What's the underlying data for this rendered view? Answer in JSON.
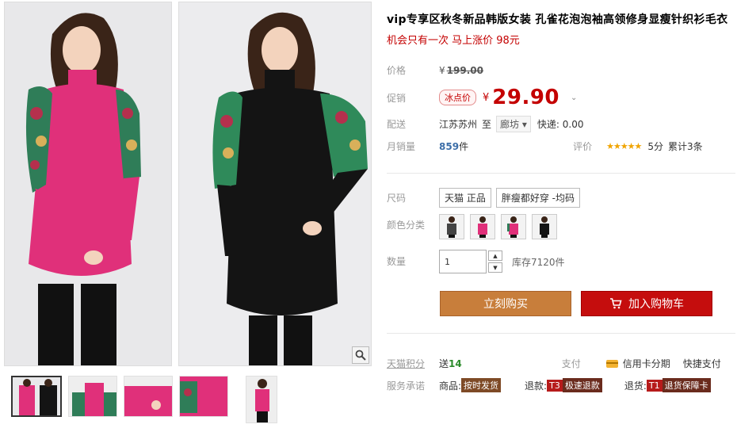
{
  "product": {
    "title": "vip专享区秋冬新品韩版女装 孔雀花泡泡袖高领修身显瘦针织衫毛衣",
    "subtitle": "机会只有一次 马上涨价 98元"
  },
  "price": {
    "label": "价格",
    "currency": "¥",
    "original": "199.00"
  },
  "promo": {
    "label": "促销",
    "tag": "冰点价",
    "currency": "¥",
    "price": "29.90"
  },
  "shipping": {
    "label": "配送",
    "from": "江苏苏州",
    "to_word": "至",
    "city": "廊坊",
    "express": "快递: 0.00"
  },
  "sales": {
    "label": "月销量",
    "count": "859",
    "unit": "件",
    "rating_label": "评价",
    "stars": "★★★★★",
    "score": "5分",
    "total": "累计3条"
  },
  "size": {
    "label": "尺码",
    "options": [
      "天猫 正品",
      "胖瘦都好穿 -均码"
    ]
  },
  "color": {
    "label": "颜色分类"
  },
  "quantity": {
    "label": "数量",
    "value": "1",
    "stock": "库存7120件"
  },
  "actions": {
    "buy": "立刻购买",
    "cart": "加入购物车",
    "cart_icon": "shopping-cart-icon"
  },
  "points": {
    "label": "天猫积分",
    "send": "送",
    "amount": "14",
    "pay_label": "支付",
    "credit": "信用卡分期",
    "quick": "快捷支付"
  },
  "service": {
    "label": "服务承诺",
    "item1_prefix": "商品:",
    "item1_tag": "按时发货",
    "item2_prefix": "退款:",
    "item2_code": "T3",
    "item2_tag": "极速退款",
    "item3_prefix": "退货:",
    "item3_code": "T1",
    "item3_tag": "退货保障卡"
  },
  "colors": {
    "pink": "#e0307a",
    "black": "#141414",
    "accent_red": "#c40000",
    "buy_orange": "#c87e3b",
    "cart_red": "#c50d0d"
  }
}
